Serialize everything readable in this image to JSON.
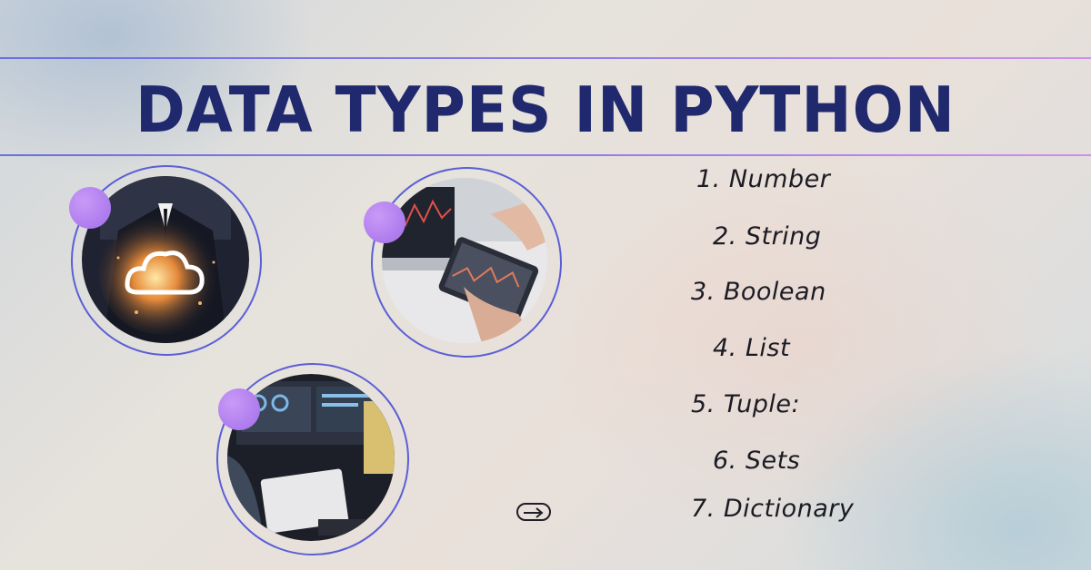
{
  "title": "DATA TYPES IN PYTHON",
  "list": [
    "1. Number",
    "2. String",
    "3. Boolean",
    "4. List",
    "5. Tuple:",
    "6. Sets",
    "7. Dictionary"
  ],
  "photos": [
    {
      "name": "cloud-computing-photo",
      "subject": "businessman holding glowing cloud icon"
    },
    {
      "name": "stock-chart-photo",
      "subject": "hands using tablet with stock charts near laptop"
    },
    {
      "name": "monitors-photo",
      "subject": "person working at desk with dashboard monitors"
    }
  ],
  "colors": {
    "title": "#20286e",
    "accent_ring": "#5a5fd6",
    "accent_dot": "#b283f0",
    "rule_start": "#6a6fe0",
    "rule_end": "#d08ef0"
  },
  "arrow_icon": "arrow-right-icon"
}
